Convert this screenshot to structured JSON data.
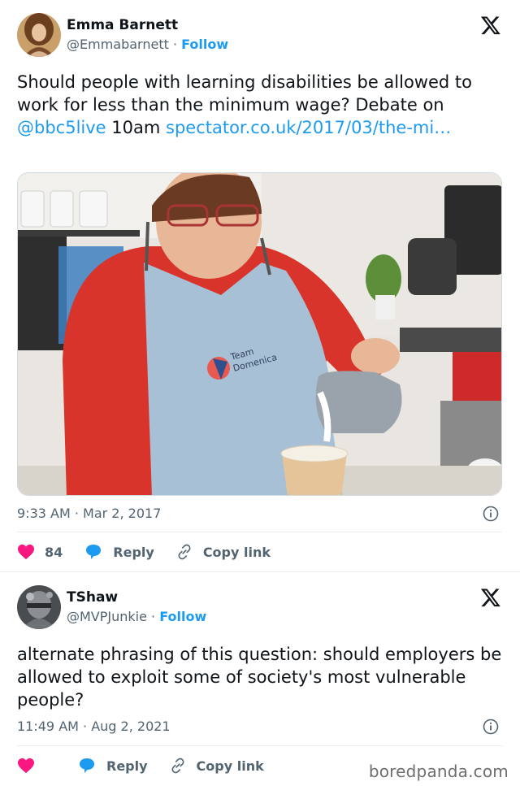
{
  "tweets": [
    {
      "author_name": "Emma Barnett",
      "handle": "@Emmabarnett",
      "separator": " · ",
      "follow_label": "Follow",
      "text_plain_1": "Should people with learning disabilities be allowed to work for less than the minimum wage? Debate on ",
      "mention": "@bbc5live",
      "text_plain_2": " 10am ",
      "url_text": "spectator.co.uk/2017/03/the-mi…",
      "timestamp": "9:33 AM · Mar 2, 2017",
      "like_count": "84",
      "reply_label": "Reply",
      "copy_link_label": "Copy link",
      "photo_apron_text_1": "Team",
      "photo_apron_text_2": "Domenica"
    },
    {
      "author_name": "TShaw",
      "handle": "@MVPJunkie",
      "separator": " · ",
      "follow_label": "Follow",
      "text": "alternate phrasing of this question: should employers be allowed to exploit some of society's most vulnerable people?",
      "timestamp": "11:49 AM · Aug 2, 2021",
      "reply_label": "Reply",
      "copy_link_label": "Copy link"
    }
  ],
  "watermark": "boredpanda.com",
  "icons": [
    "x-logo-icon",
    "info-icon",
    "heart-icon",
    "reply-bubble-icon",
    "link-icon"
  ],
  "colors": {
    "accent": "#1d9bf0",
    "like": "#f91880",
    "reply": "#1d9bf0",
    "muted": "#536471"
  }
}
